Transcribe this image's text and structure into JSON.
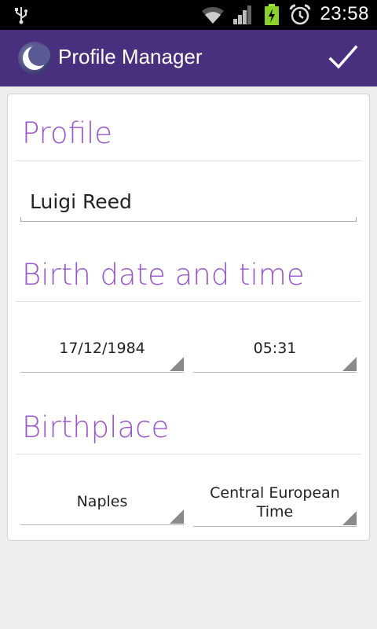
{
  "status_bar": {
    "time": "23:58",
    "icons": [
      "usb-icon",
      "wifi-icon",
      "signal-icon",
      "battery-charging-icon",
      "alarm-clock-icon"
    ]
  },
  "action_bar": {
    "title": "Profile Manager",
    "app_icon": "moon-icon",
    "done_icon": "checkmark-icon",
    "background_color": "#4b2f7f"
  },
  "form": {
    "profile": {
      "section_title": "Profile",
      "name_value": "Luigi Reed"
    },
    "birth": {
      "section_title": "Birth date and time",
      "date_value": "17/12/1984",
      "time_value": "05:31"
    },
    "birthplace": {
      "section_title": "Birthplace",
      "city_value": "Naples",
      "timezone_value_line1": "Central European",
      "timezone_value_line2": "Time"
    }
  },
  "colors": {
    "accent_purple": "#9a56cc",
    "background": "#eeeeee"
  }
}
